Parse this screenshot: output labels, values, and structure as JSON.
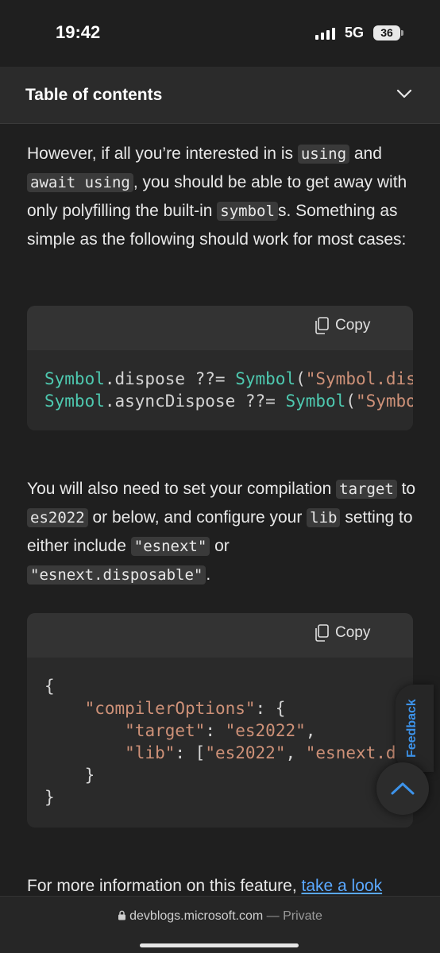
{
  "status": {
    "time": "19:42",
    "network": "5G",
    "battery": "36"
  },
  "toc": {
    "title": "Table of contents"
  },
  "para1": {
    "t1": "However, if all you’re interested in is ",
    "c1": "using",
    "t2": " and ",
    "c2": "await using",
    "t3": ", you should be able to get away with only polyfilling the built-in ",
    "c3": "symbol",
    "t4": "s. Something as simple as the following should work for most cases:"
  },
  "code1": {
    "copy_label": "Copy",
    "line1": {
      "a": "Symbol",
      "b": ".dispose ??= ",
      "c": "Symbol",
      "d": "(",
      "e": "\"Symbol.dispose\""
    },
    "line2": {
      "a": "Symbol",
      "b": ".asyncDispose ??= ",
      "c": "Symbol",
      "d": "(",
      "e": "\"Symbol.asyncDispose\""
    }
  },
  "para2": {
    "t1": "You will also need to set your compilation ",
    "c1": "target",
    "t2": " to ",
    "c2": "es2022",
    "t3": " or below, and configure your ",
    "c3": "lib",
    "t4": " setting to either include ",
    "c4": "\"esnext\"",
    "t5": " or ",
    "c5": "\"esnext.disposable\"",
    "t6": "."
  },
  "code2": {
    "copy_label": "Copy",
    "l1": "{",
    "l2a": "\"compilerOptions\"",
    "l2b": ": {",
    "l3a": "\"target\"",
    "l3b": ": ",
    "l3c": "\"es2022\"",
    "l3d": ",",
    "l4a": "\"lib\"",
    "l4b": ": [",
    "l4c": "\"es2022\"",
    "l4d": ", ",
    "l4e": "\"esnext.disposable\"",
    "l5": "}",
    "l6": "}"
  },
  "para3": {
    "text": "For more information on this feature, ",
    "link": "take a look"
  },
  "feedback": {
    "label": "Feedback"
  },
  "bottom": {
    "domain": "devblogs.microsoft.com",
    "separator": " — ",
    "private": "Private"
  },
  "colors": {
    "accent_link": "#5aa8ff",
    "background": "#1f1f1f"
  }
}
